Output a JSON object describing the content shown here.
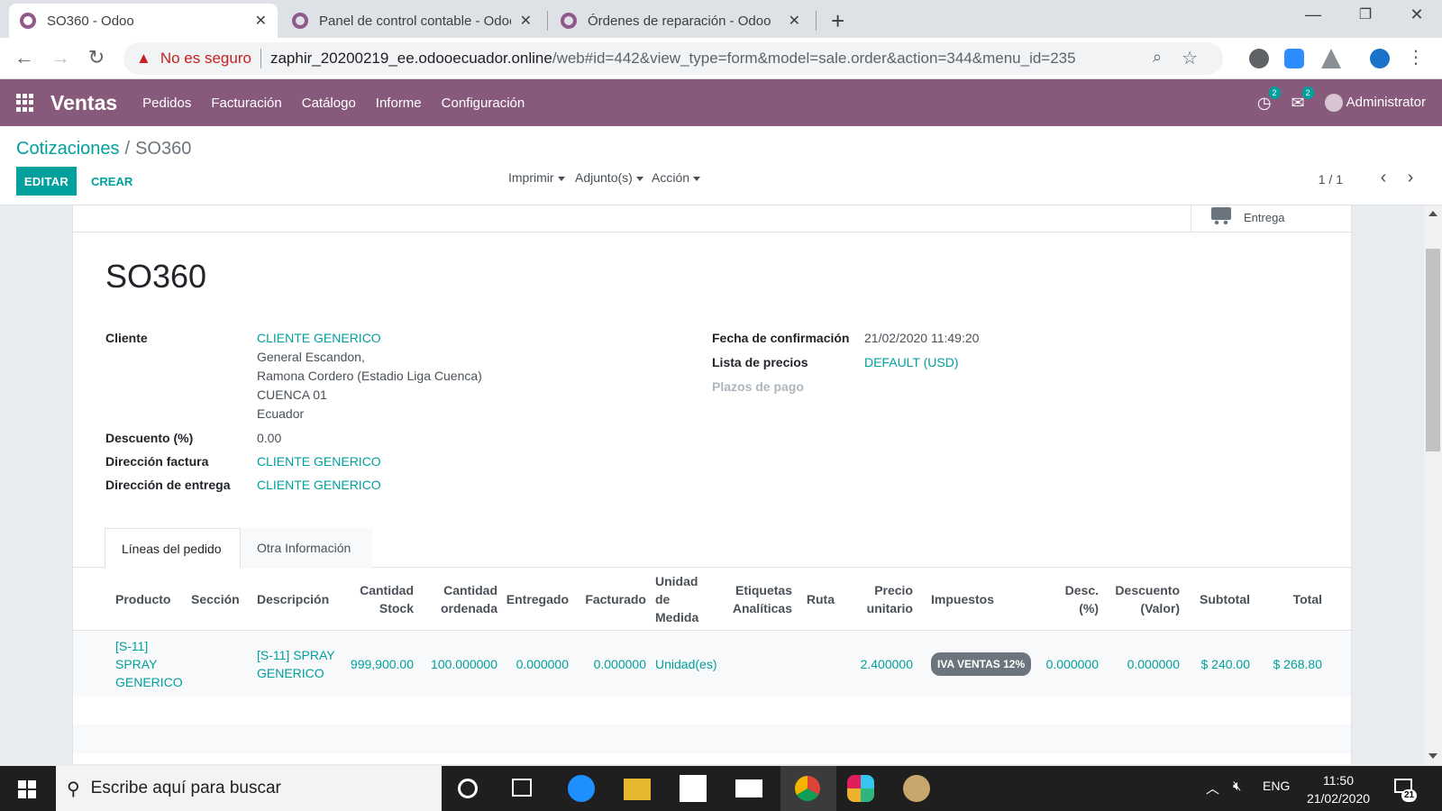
{
  "browser": {
    "tabs": [
      {
        "title": "SO360 - Odoo",
        "active": true
      },
      {
        "title": "Panel de control contable - Odoo",
        "active": false
      },
      {
        "title": "Órdenes de reparación - Odoo",
        "active": false
      }
    ],
    "security_label": "No es seguro",
    "url_host": "zaphir_20200219_ee.odooecuador.online",
    "url_path": "/web#id=442&view_type=form&model=sale.order&action=344&menu_id=235"
  },
  "odoo_nav": {
    "app_name": "Ventas",
    "menu": [
      "Pedidos",
      "Facturación",
      "Catálogo",
      "Informe",
      "Configuración"
    ],
    "activity_count": "2",
    "messages_count": "2",
    "user": "Administrator",
    "brand_color": "#875a7b"
  },
  "control_panel": {
    "breadcrumb_parent": "Cotizaciones",
    "breadcrumb_current": "SO360",
    "edit_label": "EDITAR",
    "create_label": "CREAR",
    "print_label": "Imprimir",
    "attachments_label": "Adjunto(s)",
    "action_label": "Acción",
    "pager": "1 / 1"
  },
  "form": {
    "smart_button_label": "Entrega",
    "name": "SO360",
    "labels": {
      "customer": "Cliente",
      "discount": "Descuento (%)",
      "invoice_address": "Dirección factura",
      "delivery_address": "Dirección de entrega",
      "confirmation_date": "Fecha de confirmación",
      "pricelist": "Lista de precios",
      "payment_terms": "Plazos de pago"
    },
    "customer": "CLIENTE GENERICO",
    "customer_address": [
      "General Escandon,",
      "Ramona Cordero (Estadio Liga Cuenca)",
      "CUENCA 01",
      "Ecuador"
    ],
    "discount": "0.00",
    "invoice_address": "CLIENTE GENERICO",
    "delivery_address": "CLIENTE GENERICO",
    "confirmation_date": "21/02/2020 11:49:20",
    "pricelist": "DEFAULT (USD)",
    "tabs": [
      "Líneas del pedido",
      "Otra Información"
    ]
  },
  "order_lines": {
    "headers": {
      "product": "Producto",
      "section": "Sección",
      "description": "Descripción",
      "stock_qty": "Cantidad Stock",
      "ordered_qty": "Cantidad ordenada",
      "delivered": "Entregado",
      "invoiced": "Facturado",
      "uom": "Unidad de Medida",
      "analytic_tags": "Etiquetas Analíticas",
      "route": "Ruta",
      "unit_price": "Precio unitario",
      "taxes": "Impuestos",
      "discount_pct": "Desc. (%)",
      "discount_value": "Descuento (Valor)",
      "subtotal": "Subtotal",
      "total": "Total"
    },
    "rows": [
      {
        "product": "[S-11] SPRAY GENERICO",
        "section": "",
        "description": "[S-11] SPRAY GENERICO",
        "stock_qty": "999,900.00",
        "ordered_qty": "100.000000",
        "delivered": "0.000000",
        "invoiced": "0.000000",
        "uom": "Unidad(es)",
        "analytic_tags": "",
        "route": "",
        "unit_price": "2.400000",
        "taxes": "IVA VENTAS 12%",
        "discount_pct": "0.000000",
        "discount_value": "0.000000",
        "subtotal": "$ 240.00",
        "total": "$ 268.80"
      }
    ]
  },
  "taskbar": {
    "search_placeholder": "Escribe aquí para buscar",
    "language": "ENG",
    "time": "11:50",
    "date": "21/02/2020",
    "notifications": "21"
  }
}
